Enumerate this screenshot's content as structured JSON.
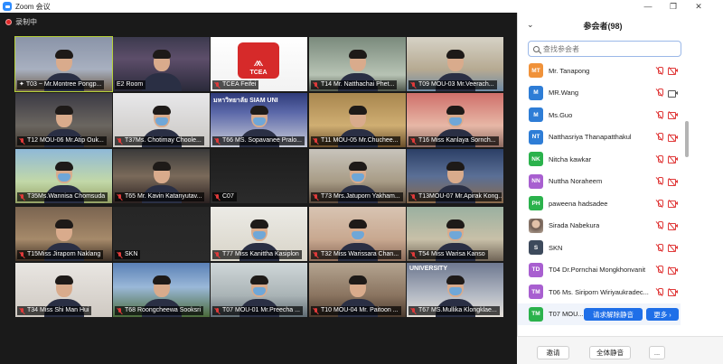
{
  "window": {
    "title": "Zoom 会议",
    "min_glyph": "—",
    "max_glyph": "❐",
    "close_glyph": "✕"
  },
  "recording": {
    "label": "录制中"
  },
  "tiles": [
    {
      "name": "T03 ~ Mr.Montree Pongp...",
      "pin": true,
      "muted": false,
      "active": true
    },
    {
      "name": "E2 Room",
      "pin": false,
      "muted": false,
      "active": false
    },
    {
      "name": "TCEA Feifei",
      "pin": false,
      "muted": true,
      "active": false,
      "logo": "TCEA"
    },
    {
      "name": "T14 Mr. Natthachai Phet...",
      "pin": false,
      "muted": true,
      "active": false
    },
    {
      "name": "T09 MOU-03 Mr.Veerach...",
      "pin": false,
      "muted": true,
      "active": false
    },
    {
      "name": "T12 MOU-06 Mr.Atip Ouk...",
      "pin": false,
      "muted": true,
      "active": false
    },
    {
      "name": "T37Ms. Chotimay Choole...",
      "pin": false,
      "muted": true,
      "active": false
    },
    {
      "name": "T66 MS. Sopavanee Pralo...",
      "pin": false,
      "muted": true,
      "active": false,
      "banner": "มหาวิทยาลัย SIAM UNI"
    },
    {
      "name": "T11 MOU-05 Mr.Chuchee...",
      "pin": false,
      "muted": true,
      "active": false
    },
    {
      "name": "T16 Miss Kanlaya Sornch...",
      "pin": false,
      "muted": true,
      "active": false
    },
    {
      "name": "T35Ms.Wannisa Chomsuda",
      "pin": false,
      "muted": true,
      "active": false
    },
    {
      "name": "T65 Mr. Kavin Katanyutav...",
      "pin": false,
      "muted": true,
      "active": false
    },
    {
      "name": "C07",
      "pin": false,
      "muted": true,
      "active": false
    },
    {
      "name": "T73 Mrs.Jatuporn Yakham...",
      "pin": false,
      "muted": true,
      "active": false
    },
    {
      "name": "T13MOU-07 Mr.Apirak Kong...",
      "pin": false,
      "muted": true,
      "active": false
    },
    {
      "name": "T15Miss Jiraporn Naklang",
      "pin": false,
      "muted": true,
      "active": false
    },
    {
      "name": "SKN",
      "pin": false,
      "muted": true,
      "active": false,
      "bigtext": "SKN"
    },
    {
      "name": "T77 Miss Kanittha Kasiplon",
      "pin": false,
      "muted": true,
      "active": false
    },
    {
      "name": "T32 Miss Warissara Chan...",
      "pin": false,
      "muted": true,
      "active": false
    },
    {
      "name": "T54 Miss Warisa Kanso",
      "pin": false,
      "muted": true,
      "active": false
    },
    {
      "name": "T34 Miss Shi Man Hui",
      "pin": false,
      "muted": true,
      "active": false
    },
    {
      "name": "T68 Roongcheewa Sooksri",
      "pin": false,
      "muted": true,
      "active": false
    },
    {
      "name": "T07 MOU-01 Mr.Preecha ...",
      "pin": false,
      "muted": true,
      "active": false
    },
    {
      "name": "T10 MOU-04 Mr. Paitoon ...",
      "pin": false,
      "muted": true,
      "active": false
    },
    {
      "name": "T67 MS.Mullika Klongklae...",
      "pin": false,
      "muted": true,
      "active": false,
      "banner": "UNIVERSITY"
    }
  ],
  "panel": {
    "title": "参会者(98)",
    "collapse_glyph": "⌄",
    "search_placeholder": "查找参会者",
    "participants": [
      {
        "initials": "MT",
        "name": "Mr. Tanapong",
        "color": "#f0923a",
        "cam_on": false
      },
      {
        "initials": "M",
        "name": "MR.Wang",
        "color": "#2e7dd6",
        "cam_on": true
      },
      {
        "initials": "M",
        "name": "Ms.Guo",
        "color": "#2e7dd6",
        "cam_on": false
      },
      {
        "initials": "NT",
        "name": "Natthasriya Thanapatthakul",
        "color": "#2e7dd6",
        "cam_on": false
      },
      {
        "initials": "NK",
        "name": "Nitcha kawkar",
        "color": "#2bb24c",
        "cam_on": false
      },
      {
        "initials": "NN",
        "name": "Nuttha Noraheem",
        "color": "#a85fd0",
        "cam_on": false
      },
      {
        "initials": "PH",
        "name": "paweena hadsadee",
        "color": "#2bb24c",
        "cam_on": false
      },
      {
        "initials": "",
        "name": "Sirada  Nabekura",
        "color": "#8f7a6e",
        "cam_on": false,
        "photo": true
      },
      {
        "initials": "S",
        "name": "SKN",
        "color": "#3d4a5c",
        "cam_on": false
      },
      {
        "initials": "TD",
        "name": "T04 Dr.Pornchai Mongkhonvanit",
        "color": "#a85fd0",
        "cam_on": false
      },
      {
        "initials": "TM",
        "name": "T06 Ms. Siriporn Wiriyaukradec...",
        "color": "#a85fd0",
        "cam_on": false
      },
      {
        "initials": "TM",
        "name": "T07 MOU...",
        "color": "#2bb24c",
        "cam_on": false,
        "hover": true
      },
      {
        "initials": "TM",
        "name": "T08 MOU...",
        "color": "#2e7dd6",
        "cam_on": false
      }
    ],
    "ask_unmute_label": "请求解除静音",
    "more_label": "更多 ›",
    "footer": {
      "invite_label": "邀请",
      "mute_all_label": "全体静音",
      "more_label": "..."
    }
  }
}
